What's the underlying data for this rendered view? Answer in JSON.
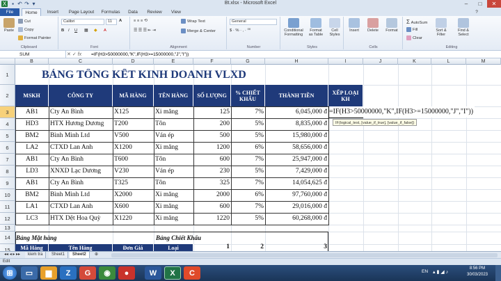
{
  "window": {
    "title": "Bt.xlsx - Microsoft Excel"
  },
  "ribbon_tabs": [
    "File",
    "Home",
    "Insert",
    "Page Layout",
    "Formulas",
    "Data",
    "Review",
    "View"
  ],
  "clipboard": {
    "cut": "Cut",
    "copy": "Copy",
    "format_painter": "Format Painter",
    "paste": "Paste",
    "label": "Clipboard"
  },
  "font": {
    "name": "Calibri",
    "size": "11",
    "label": "Font"
  },
  "alignment": {
    "wrap": "Wrap Text",
    "merge": "Merge & Center",
    "label": "Alignment"
  },
  "number": {
    "format": "General",
    "label": "Number"
  },
  "styles": {
    "cond": "Conditional Formatting",
    "table": "Format as Table",
    "cell": "Cell Styles",
    "label": "Styles"
  },
  "cells": {
    "insert": "Insert",
    "delete": "Delete",
    "format": "Format",
    "label": "Cells"
  },
  "editing": {
    "autosum": "AutoSum",
    "fill": "Fill",
    "clear": "Clear",
    "sort": "Sort & Filter",
    "find": "Find & Select",
    "label": "Editing"
  },
  "formula_bar": {
    "name_box": "SUM",
    "formula": "=IF(H3>50000000,\"K\",IF(H3>=15000000,\"J\",\"I\"))"
  },
  "columns": [
    "B",
    "C",
    "D",
    "E",
    "F",
    "G",
    "H",
    "I",
    "J",
    "K",
    "L",
    "M"
  ],
  "rows": [
    "1",
    "2",
    "3",
    "4",
    "5",
    "6",
    "7",
    "8",
    "9",
    "10",
    "11",
    "12",
    "13",
    "14",
    "15"
  ],
  "sheet": {
    "title": "BẢNG TỔNG KẾT KINH DOANH VLXD",
    "headers": [
      "MSKH",
      "CÔNG TY",
      "MÃ HÀNG",
      "TÊN HÀNG",
      "SỐ LƯỢNG",
      "% CHIẾT KHẤU",
      "THÀNH TIỀN",
      "XẾP LOẠI KH"
    ],
    "data": [
      [
        "AB1",
        "Cty An Bình",
        "X125",
        "Xi măng",
        "125",
        "7%",
        "6,045,000 đ"
      ],
      [
        "HD3",
        "HTX Hương Dương",
        "T200",
        "Tôn",
        "200",
        "5%",
        "8,835,000 đ"
      ],
      [
        "BM2",
        "Bình Minh Ltd",
        "V500",
        "Ván ép",
        "500",
        "5%",
        "15,980,000 đ"
      ],
      [
        "LA2",
        "CTXD Lan Anh",
        "X1200",
        "Xi măng",
        "1200",
        "6%",
        "58,656,000 đ"
      ],
      [
        "AB1",
        "Cty An Bình",
        "T600",
        "Tôn",
        "600",
        "7%",
        "25,947,000 đ"
      ],
      [
        "LD3",
        "XNXD Lạc Dương",
        "V230",
        "Ván ép",
        "230",
        "5%",
        "7,429,000 đ"
      ],
      [
        "AB1",
        "Cty An Bình",
        "T325",
        "Tôn",
        "325",
        "7%",
        "14,054,625 đ"
      ],
      [
        "BM2",
        "Bình Minh Ltd",
        "X2000",
        "Xi măng",
        "2000",
        "6%",
        "97,760,000 đ"
      ],
      [
        "LA1",
        "CTXD Lan Anh",
        "X600",
        "Xi măng",
        "600",
        "7%",
        "29,016,000 đ"
      ],
      [
        "LC3",
        "HTX Dệt Hoa Quỳ",
        "X1220",
        "Xi măng",
        "1220",
        "5%",
        "60,268,000 đ"
      ]
    ],
    "editing_formula": "=IF(H3>50000000,\"K\",IF(H3>=15000000,\"J\",\"I\"))",
    "tooltip": "IF(logical_test, [value_if_true], [value_if_false])",
    "lookup1_title": "Bảng Mặt hàng",
    "lookup2_title": "Bảng Chiết Khấu",
    "row15": {
      "b": "Mã Hàng",
      "c": "Tên Hàng",
      "d": "Đơn Giá",
      "e": "Loại",
      "f": "1",
      "g": "2",
      "h": "3"
    }
  },
  "sheet_tabs": [
    "kiem tra",
    "Sheet1",
    "Sheet2"
  ],
  "status": {
    "mode": "Edit"
  },
  "taskbar": {
    "lang": "EN",
    "time": "8:56 PM",
    "date": "30/03/2023"
  }
}
